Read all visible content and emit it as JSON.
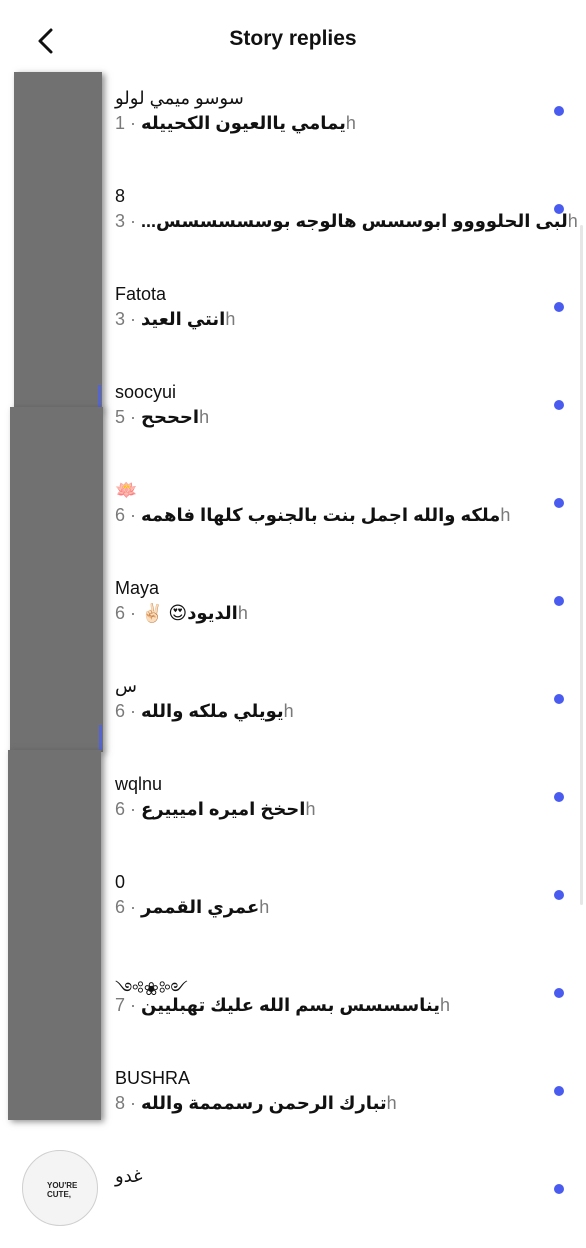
{
  "header": {
    "title": "Story replies",
    "back_icon": "chevron-left-icon"
  },
  "colors": {
    "unread_dot": "#4a5cf0",
    "time_text": "#7a7a7a",
    "avatar_redaction": "#717171"
  },
  "replies": [
    {
      "name": "سوسو ميمي لولو",
      "message": "يمامي ياالعيون الكحييله",
      "time": "1h"
    },
    {
      "name": "8",
      "message": "لبى الحلوووو ابوسسس هالوجه بوسسسسسس...",
      "time": "3h"
    },
    {
      "name": "Fatota",
      "message": "انتي العيد",
      "time": "3h"
    },
    {
      "name": "soocyui",
      "message": "احححح",
      "time": "5h"
    },
    {
      "name": "🪷",
      "message": "ملكه والله اجمل بنت بالجنوب كلهاا فاهمه",
      "time": "6h"
    },
    {
      "name": "Maya",
      "message": "الديود😍 ✌🏻",
      "time": "6h"
    },
    {
      "name": "س",
      "message": "يويلي ملكه والله",
      "time": "6h"
    },
    {
      "name": "wqlnu",
      "message": "احخخ اميره اميييرع",
      "time": "6h"
    },
    {
      "name": "0",
      "message": "عمري القممر",
      "time": "6h"
    },
    {
      "name": "༺❀༻",
      "message": "يناسسسس بسم الله عليك تهبليين",
      "time": "7h"
    },
    {
      "name": "BUSHRA",
      "message": "تبارك الرحمن رسمممة والله",
      "time": "8h"
    },
    {
      "name": "غدو",
      "message": "",
      "time": ""
    }
  ],
  "partial_avatar_text": "YOU'RE CUTE,"
}
